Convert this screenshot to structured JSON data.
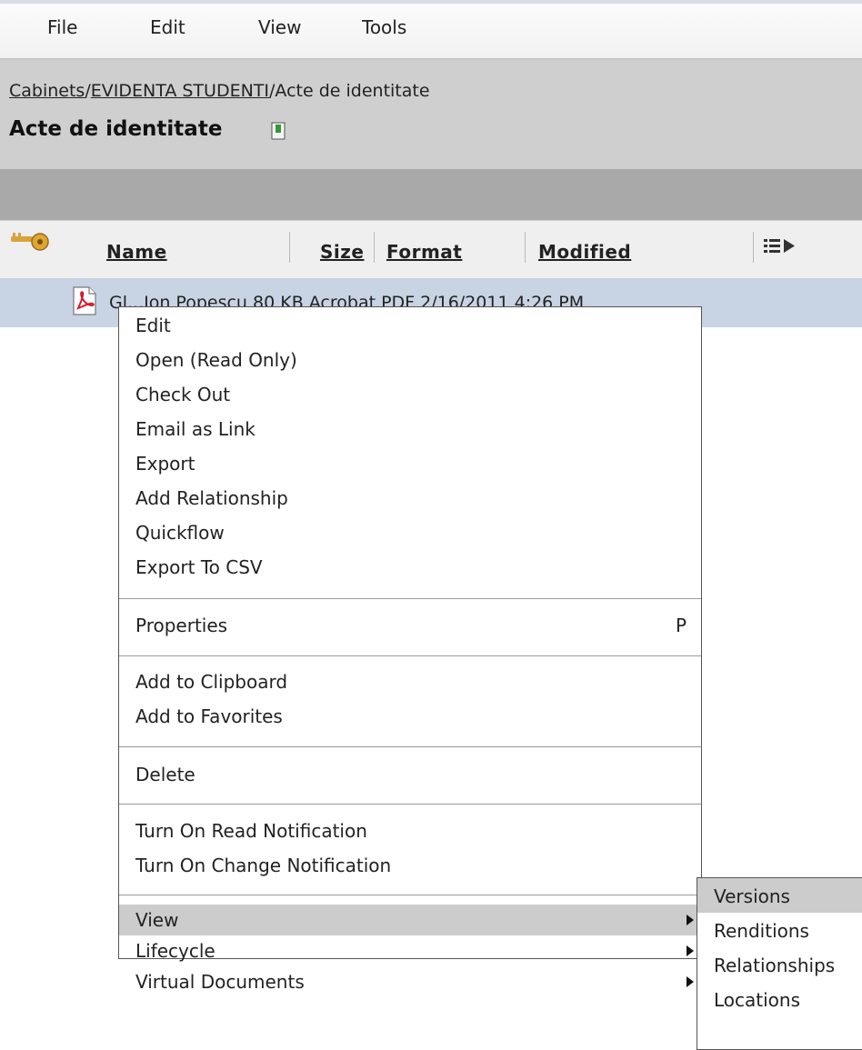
{
  "menubar": {
    "items": [
      "File",
      "Edit",
      "View",
      "Tools"
    ]
  },
  "header": {
    "breadcrumb": {
      "root": "Cabinets",
      "sep1": "/",
      "cabinet": "EVIDENTA STUDENTI",
      "sep2": "/",
      "current": "Acte de identitate"
    },
    "title": "Acte de identitate"
  },
  "columns": {
    "name": "Name",
    "size": "Size",
    "format": "Format",
    "modified": "Modified"
  },
  "row": {
    "visible_text": "Gl...Ion Popescu  80 KB  Acrobat PDF  2/16/2011 4:26 PM"
  },
  "context_menu": {
    "items": [
      {
        "label": "Edit"
      },
      {
        "label": "Open (Read Only)"
      },
      {
        "label": "Check Out"
      },
      {
        "label": "Email as Link"
      },
      {
        "label": "Export"
      },
      {
        "label": "Add Relationship"
      },
      {
        "label": "Quickflow"
      },
      {
        "label": "Export To CSV"
      },
      {
        "label": "Properties",
        "shortcut": "P"
      },
      {
        "label": "Add to Clipboard"
      },
      {
        "label": "Add to Favorites"
      },
      {
        "label": "Delete"
      },
      {
        "label": "Turn On Read Notification"
      },
      {
        "label": "Turn On Change Notification"
      },
      {
        "label": "View"
      },
      {
        "label": "Lifecycle"
      },
      {
        "label": "Virtual Documents"
      }
    ]
  },
  "submenu": {
    "items": [
      "Versions",
      "Renditions",
      "Relationships",
      "Locations"
    ]
  },
  "colors": {
    "header_bg": "#cfcfcf",
    "dark_bar": "#a9a9a9",
    "row_selected": "#c8d3e4",
    "menu_highlight": "#cccccc"
  },
  "icons": [
    "key-icon",
    "column-picker-icon",
    "pdf-file-icon",
    "document-icon",
    "submenu-arrow-icon"
  ]
}
